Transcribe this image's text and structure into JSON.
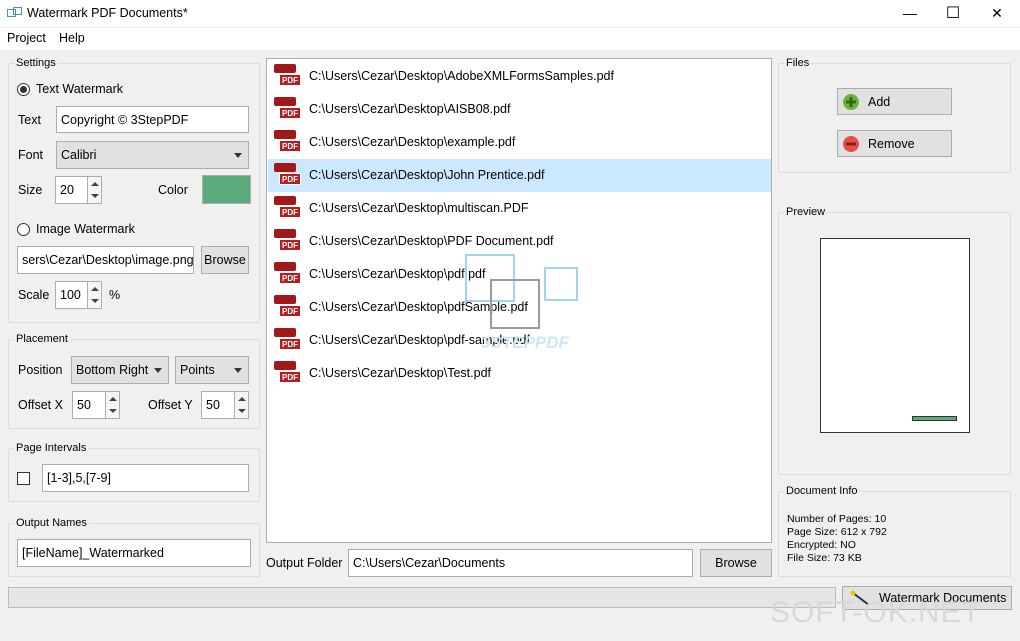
{
  "window": {
    "title": "Watermark PDF Documents*",
    "minimize": "—",
    "maximize": "☐",
    "close": "✕"
  },
  "menu": [
    "Project",
    "Help"
  ],
  "settings": {
    "group": "Settings",
    "text_watermark_label": "Text Watermark",
    "text_label": "Text",
    "text_value": "Copyright © 3StepPDF",
    "font_label": "Font",
    "font_value": "Calibri",
    "size_label": "Size",
    "size_value": "20",
    "color_label": "Color",
    "color_value": "#5aab7b",
    "image_watermark_label": "Image Watermark",
    "image_path": "sers\\Cezar\\Desktop\\image.png",
    "browse_label": "Browse",
    "scale_label": "Scale",
    "scale_value": "100",
    "scale_unit": "%"
  },
  "placement": {
    "group": "Placement",
    "position_label": "Position",
    "position_value": "Bottom Right",
    "unit_value": "Points",
    "offset_x_label": "Offset X",
    "offset_x_value": "50",
    "offset_y_label": "Offset Y",
    "offset_y_value": "50"
  },
  "page_intervals": {
    "group": "Page Intervals",
    "value": "[1-3],5,[7-9]"
  },
  "output_names": {
    "group": "Output Names",
    "value": "[FileName]_Watermarked"
  },
  "files": [
    "C:\\Users\\Cezar\\Desktop\\AdobeXMLFormsSamples.pdf",
    "C:\\Users\\Cezar\\Desktop\\AISB08.pdf",
    "C:\\Users\\Cezar\\Desktop\\example.pdf",
    "C:\\Users\\Cezar\\Desktop\\John Prentice.pdf",
    "C:\\Users\\Cezar\\Desktop\\multiscan.PDF",
    "C:\\Users\\Cezar\\Desktop\\PDF Document.pdf",
    "C:\\Users\\Cezar\\Desktop\\pdf.pdf",
    "C:\\Users\\Cezar\\Desktop\\pdfSample.pdf",
    "C:\\Users\\Cezar\\Desktop\\pdf-sample.pdf",
    "C:\\Users\\Cezar\\Desktop\\Test.pdf"
  ],
  "pdf_tag": "PDF",
  "selected_file_index": 3,
  "watermark_logo_text": "3STEPPDF",
  "output": {
    "label": "Output Folder",
    "value": "C:\\Users\\Cezar\\Documents",
    "browse_label": "Browse"
  },
  "files_panel": {
    "group": "Files",
    "add_label": "Add",
    "remove_label": "Remove"
  },
  "preview": {
    "group": "Preview"
  },
  "document_info": {
    "group": "Document Info",
    "pages": "Number of Pages: 10",
    "page_size": "Page Size: 612 x 792",
    "encrypted": "Encrypted: NO",
    "file_size": "File Size: 73 KB"
  },
  "action": {
    "watermark_button": "Watermark Documents"
  },
  "brand_overlay": "SOFT-OK.NET"
}
